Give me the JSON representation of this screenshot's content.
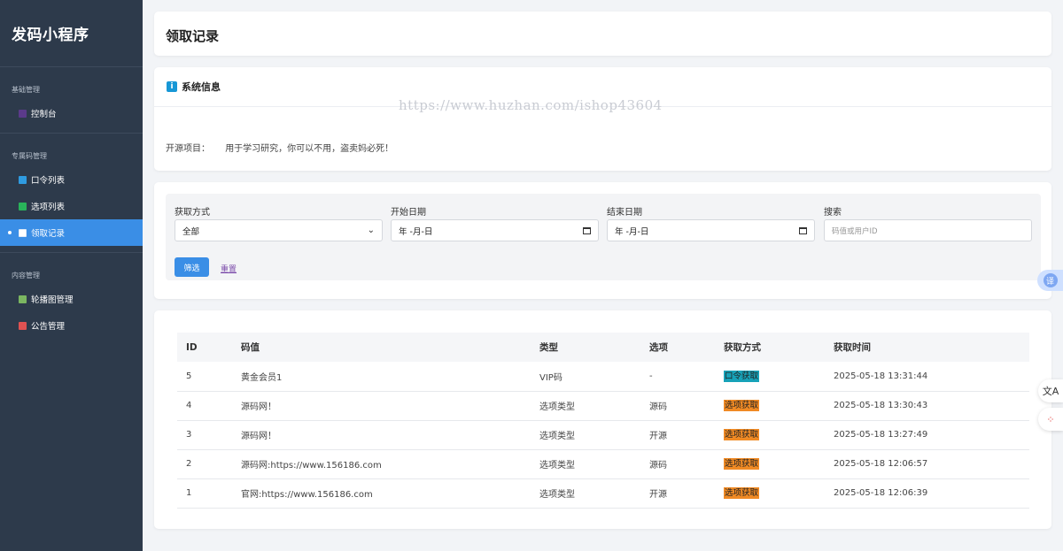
{
  "sidebar": {
    "app_title": "发码小程序",
    "sections": [
      {
        "title": "基础管理",
        "items": [
          {
            "label": "控制台",
            "icon": "dashboard-icon",
            "color": "#5b3a8a"
          }
        ]
      },
      {
        "title": "专属码管理",
        "items": [
          {
            "label": "口令列表",
            "icon": "grid-icon",
            "color": "#2f9be0"
          },
          {
            "label": "选项列表",
            "icon": "check-icon",
            "color": "#29b35a"
          },
          {
            "label": "领取记录",
            "icon": "table-icon",
            "color": "#ffffff",
            "active": true
          }
        ]
      },
      {
        "title": "内容管理",
        "items": [
          {
            "label": "轮播图管理",
            "icon": "image-icon",
            "color": "#7bb661"
          },
          {
            "label": "公告管理",
            "icon": "megaphone-icon",
            "color": "#e05252"
          }
        ]
      }
    ]
  },
  "page": {
    "title": "领取记录"
  },
  "system_info": {
    "header": "系统信息",
    "label": "开源项目：",
    "text": "用于学习研究，你可以不用，盗卖妈必死！",
    "watermark": "https://www.huzhan.com/ishop43604"
  },
  "filter": {
    "method_label": "获取方式",
    "method_value": "全部",
    "start_label": "开始日期",
    "start_value": "年 -月-日",
    "end_label": "结束日期",
    "end_value": "年 -月-日",
    "search_label": "搜索",
    "search_placeholder": "码值或用户ID",
    "filter_button": "筛选",
    "reset_link": "重置"
  },
  "table": {
    "headers": [
      "ID",
      "码值",
      "类型",
      "选项",
      "获取方式",
      "获取时间"
    ],
    "rows": [
      {
        "id": "5",
        "code": "黄金会员1",
        "type": "VIP码",
        "option": "-",
        "method": "口令获取",
        "method_color": "#17a2b8",
        "time": "2025-05-18 13:31:44"
      },
      {
        "id": "4",
        "code": "源码网！",
        "type": "选项类型",
        "option": "源码",
        "method": "选项获取",
        "method_color": "#f08a24",
        "time": "2025-05-18 13:30:43"
      },
      {
        "id": "3",
        "code": "源码网！",
        "type": "选项类型",
        "option": "开源",
        "method": "选项获取",
        "method_color": "#f08a24",
        "time": "2025-05-18 13:27:49"
      },
      {
        "id": "2",
        "code": "源码网:https://www.156186.com",
        "type": "选项类型",
        "option": "源码",
        "method": "选项获取",
        "method_color": "#f08a24",
        "time": "2025-05-18 12:06:57"
      },
      {
        "id": "1",
        "code": "官网:https://www.156186.com",
        "type": "选项类型",
        "option": "开源",
        "method": "选项获取",
        "method_color": "#f08a24",
        "time": "2025-05-18 12:06:39"
      }
    ]
  },
  "floating": {
    "translate_label": "译",
    "ai_icon": "文A",
    "apps_icon": "⁘"
  }
}
